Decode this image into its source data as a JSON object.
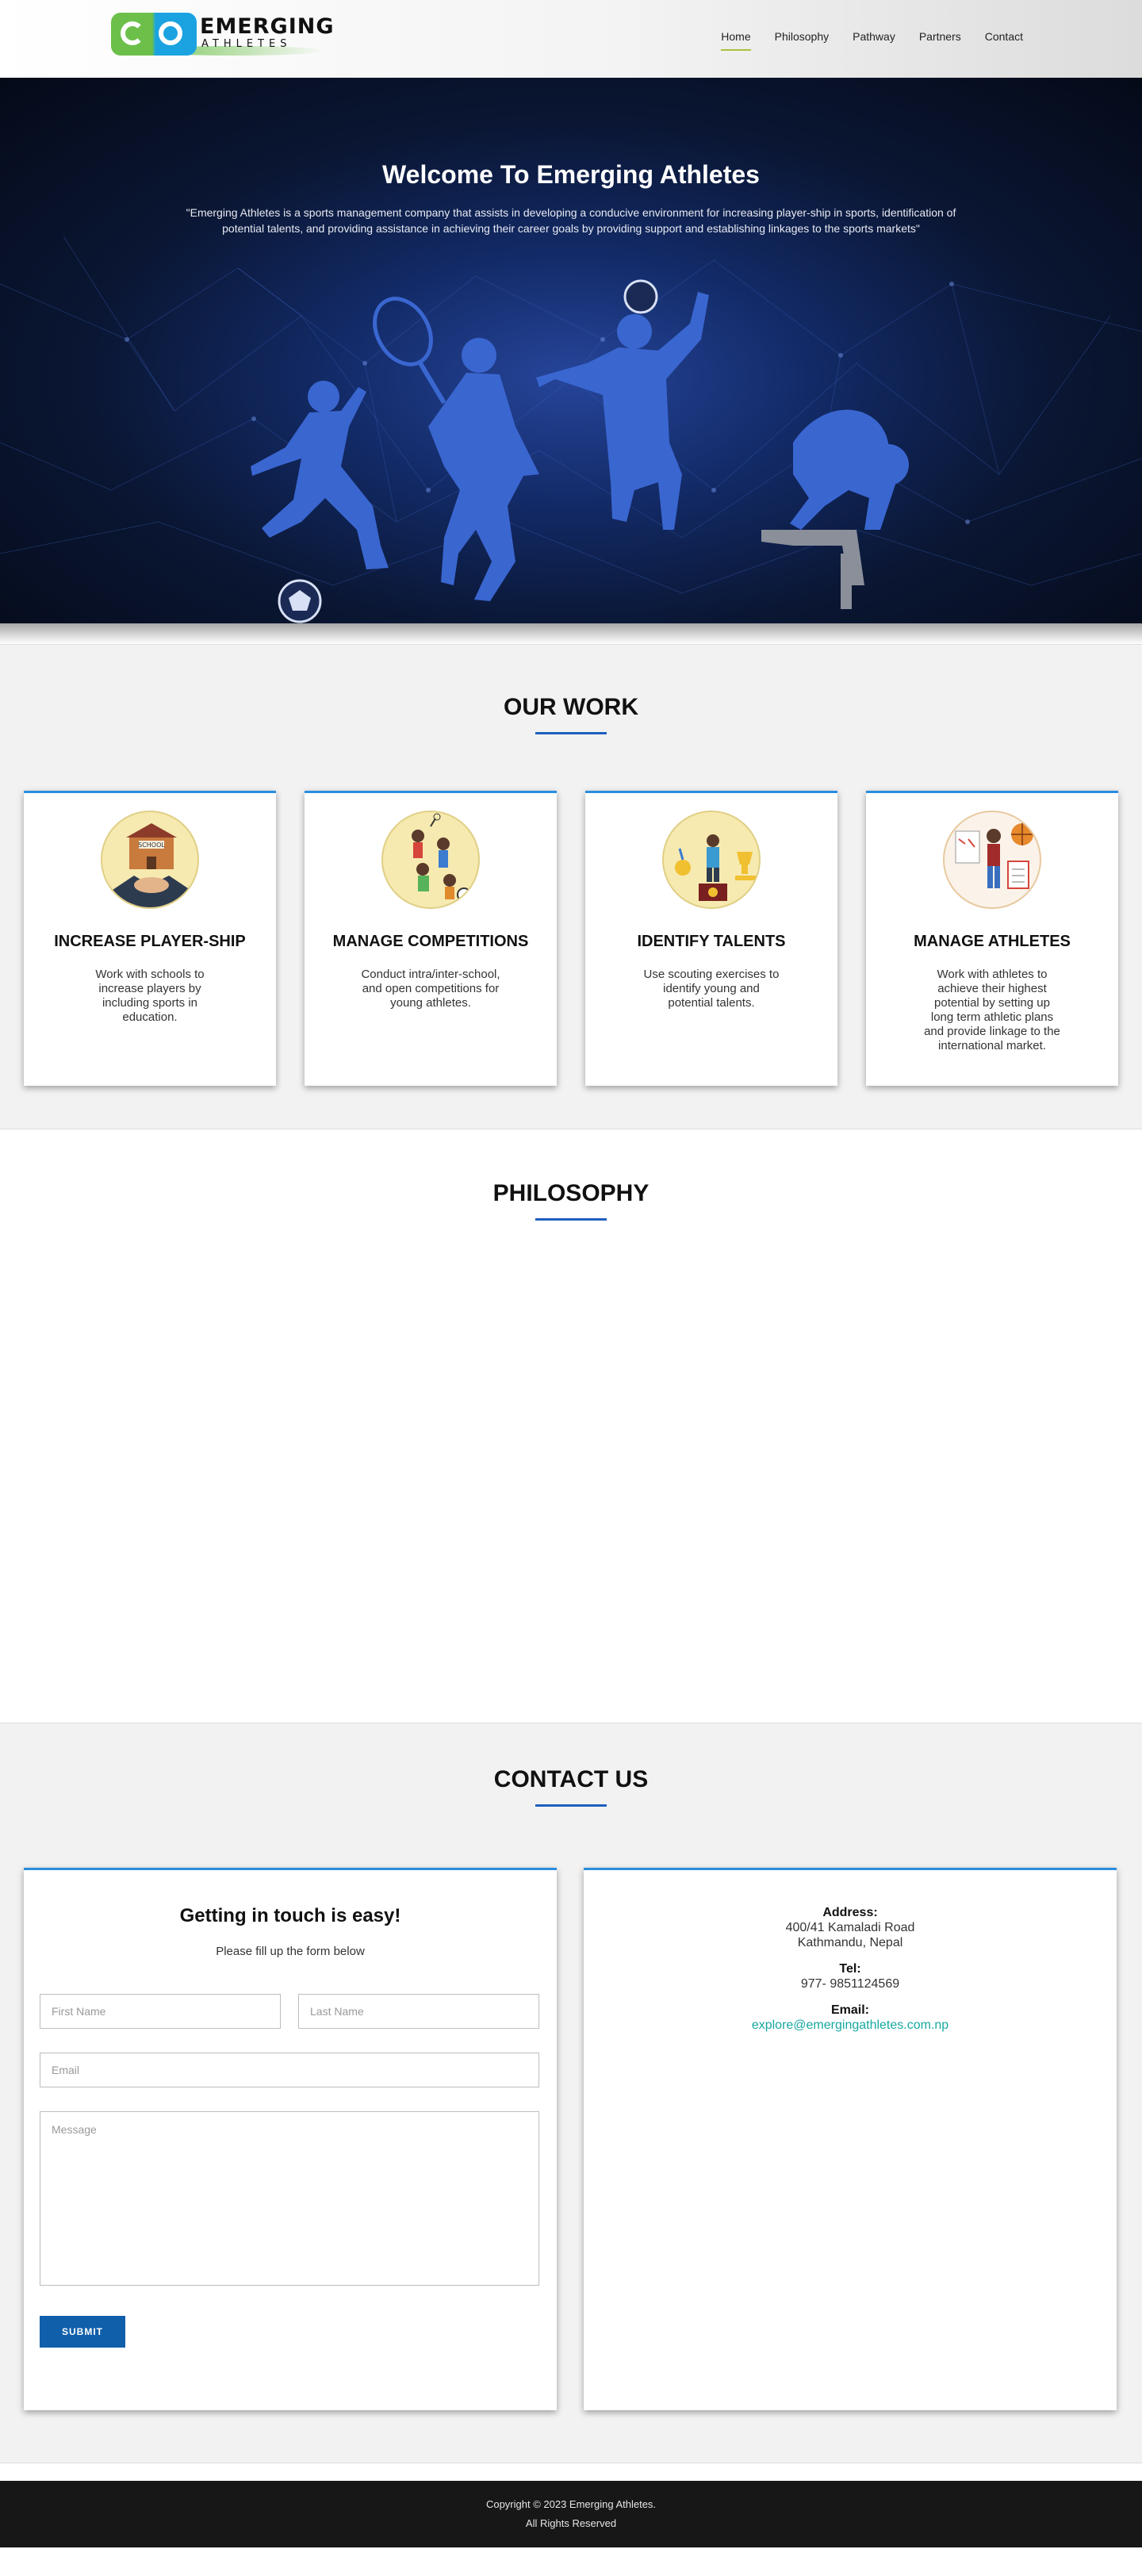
{
  "brand": {
    "logo_line1": "EMERGING",
    "logo_line2": "ATHLETES",
    "primary_green": "#6cc04a",
    "primary_blue": "#1aa3e0"
  },
  "nav": {
    "items": [
      {
        "label": "Home",
        "active": true
      },
      {
        "label": "Philosophy",
        "active": false
      },
      {
        "label": "Pathway",
        "active": false
      },
      {
        "label": "Partners",
        "active": false
      },
      {
        "label": "Contact",
        "active": false
      }
    ]
  },
  "hero": {
    "title": "Welcome To Emerging Athletes",
    "description": "\"Emerging Athletes is a sports management company that assists in developing a conducive environment for increasing player-ship in sports, identification of potential talents, and providing assistance in achieving their career goals by providing support and establishing linkages to the sports markets\""
  },
  "work": {
    "title": "OUR WORK",
    "cards": [
      {
        "title": "INCREASE PLAYER-SHIP",
        "text": "Work with schools to increase players by including sports in education.",
        "icon": "school-handshake-icon"
      },
      {
        "title": "MANAGE COMPETITIONS",
        "text": "Conduct intra/inter-school, and open competitions for young athletes.",
        "icon": "competition-players-icon"
      },
      {
        "title": "IDENTIFY TALENTS",
        "text": "Use scouting exercises to identify young and potential talents.",
        "icon": "trophy-podium-icon"
      },
      {
        "title": "MANAGE ATHLETES",
        "text": "Work with athletes to achieve their highest potential by setting up long term athletic plans and provide linkage to the international market.",
        "icon": "athlete-plan-icon"
      }
    ]
  },
  "philosophy": {
    "title": "PHILOSOPHY"
  },
  "contact": {
    "title": "CONTACT US",
    "form": {
      "heading": "Getting in touch is easy!",
      "subheading": "Please fill up the form below",
      "first_name_placeholder": "First Name",
      "last_name_placeholder": "Last Name",
      "email_placeholder": "Email",
      "message_placeholder": "Message",
      "submit_label": "SUBMIT"
    },
    "info": {
      "address_label": "Address:",
      "address_line1": "400/41 Kamaladi Road",
      "address_line2": "Kathmandu, Nepal",
      "tel_label": "Tel:",
      "tel_value": "977- 9851124569",
      "email_label": "Email:",
      "email_value": "explore@emergingathletes.com.np"
    }
  },
  "footer": {
    "line1": "Copyright © 2023 Emerging Athletes.",
    "line2": "All Rights Reserved"
  }
}
